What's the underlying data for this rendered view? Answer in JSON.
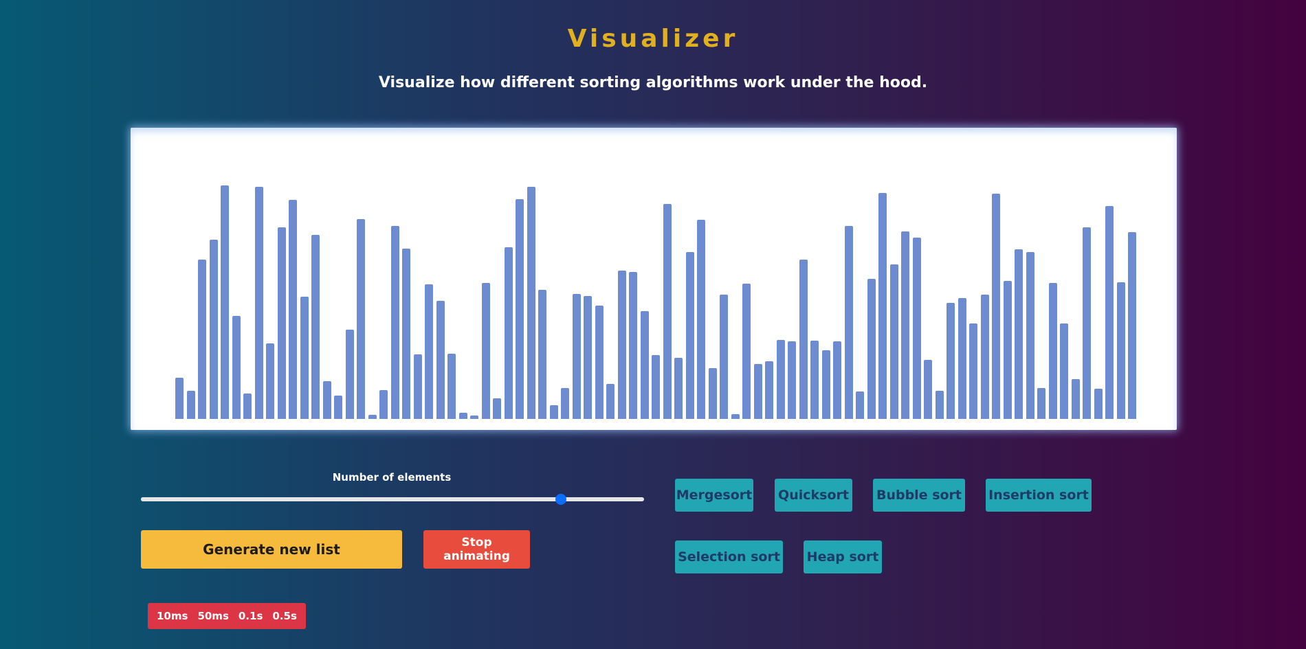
{
  "header": {
    "title": "Visualizer",
    "subtitle": "Visualize how different sorting algorithms work under the hood."
  },
  "chart_data": {
    "type": "bar",
    "values": [
      60,
      41,
      232,
      261,
      340,
      150,
      37,
      338,
      110,
      279,
      319,
      178,
      268,
      55,
      34,
      130,
      291,
      6,
      42,
      281,
      248,
      94,
      196,
      172,
      95,
      9,
      5,
      198,
      30,
      250,
      320,
      338,
      188,
      20,
      45,
      182,
      179,
      165,
      51,
      216,
      214,
      157,
      93,
      313,
      89,
      243,
      290,
      74,
      181,
      7,
      197,
      80,
      84,
      115,
      113,
      232,
      114,
      100,
      113,
      281,
      40,
      204,
      329,
      225,
      273,
      264,
      86,
      41,
      169,
      176,
      139,
      181,
      328,
      201,
      247,
      243,
      45,
      198,
      139,
      58,
      279,
      44,
      310,
      199,
      272
    ],
    "ylim": [
      0,
      345
    ],
    "color": "#6c8bd0"
  },
  "controls": {
    "slider_label": "Number of elements",
    "slider_value": 0.835,
    "generate_label": "Generate new list",
    "stop_label": "Stop animating",
    "speeds": [
      "10ms",
      "50ms",
      "0.1s",
      "0.5s"
    ]
  },
  "algorithms": [
    "Mergesort",
    "Quicksort",
    "Bubble sort",
    "Insertion sort",
    "Selection sort",
    "Heap sort"
  ],
  "colors": {
    "title": "#e0b020",
    "generate": "#f6ba3c",
    "stop": "#e74c3c",
    "speed": "#dc3545",
    "algo": "#22a6b3",
    "algo_text": "#1e3a66"
  }
}
